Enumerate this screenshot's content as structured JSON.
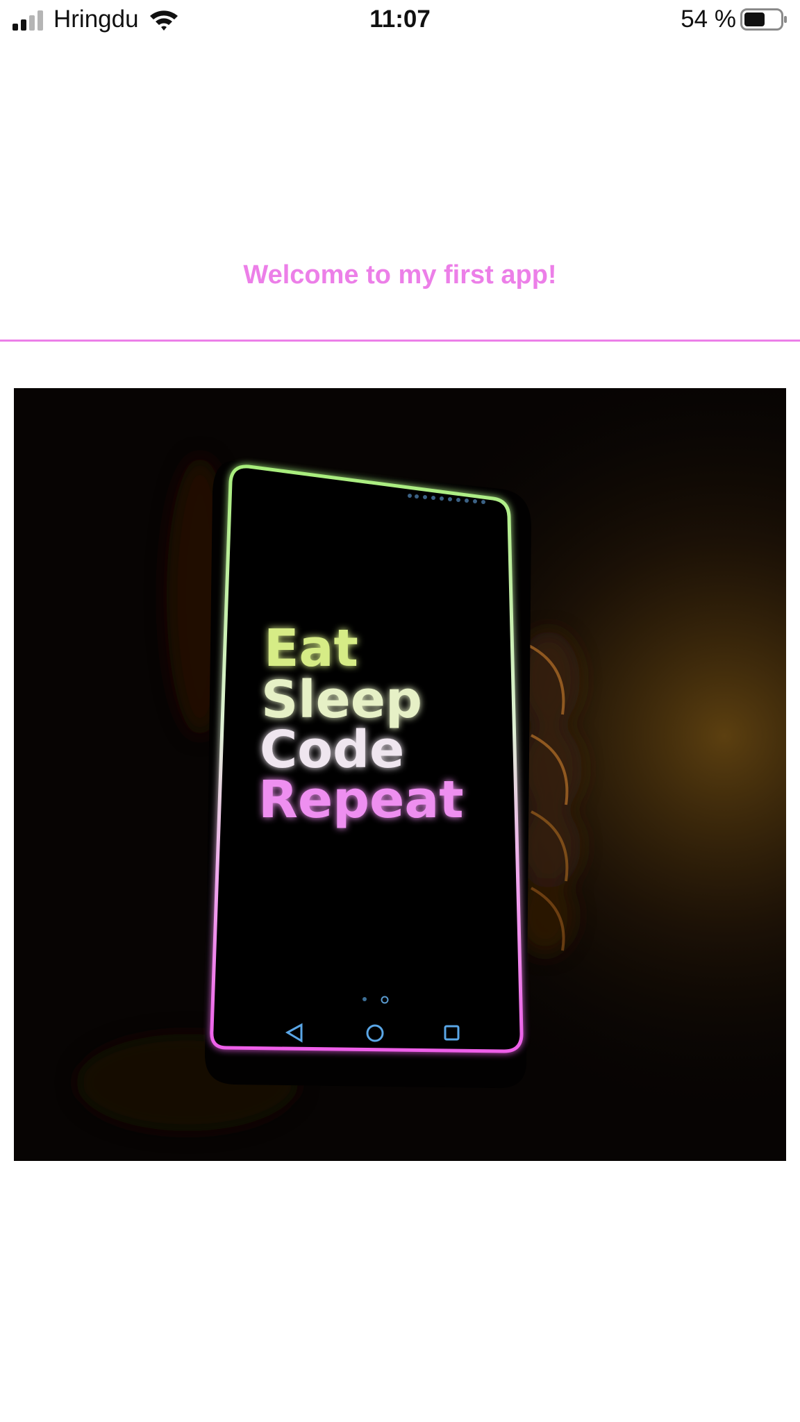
{
  "status_bar": {
    "carrier": "Hringdu",
    "time": "11:07",
    "battery": "54 %",
    "icons": [
      "signal-icon",
      "wifi-icon",
      "battery-icon"
    ]
  },
  "header": {
    "title": "Welcome to my first app!"
  },
  "hero_image": {
    "screen_text": {
      "line1": "Eat",
      "line2": "Sleep",
      "line3": "Code",
      "line4": "Repeat"
    },
    "colors": {
      "accent_green": "#b7f07a",
      "accent_pink": "#ee6ff0"
    }
  },
  "colors": {
    "accent": "#ec7fe8",
    "background": "#ffffff",
    "text": "#111111"
  }
}
